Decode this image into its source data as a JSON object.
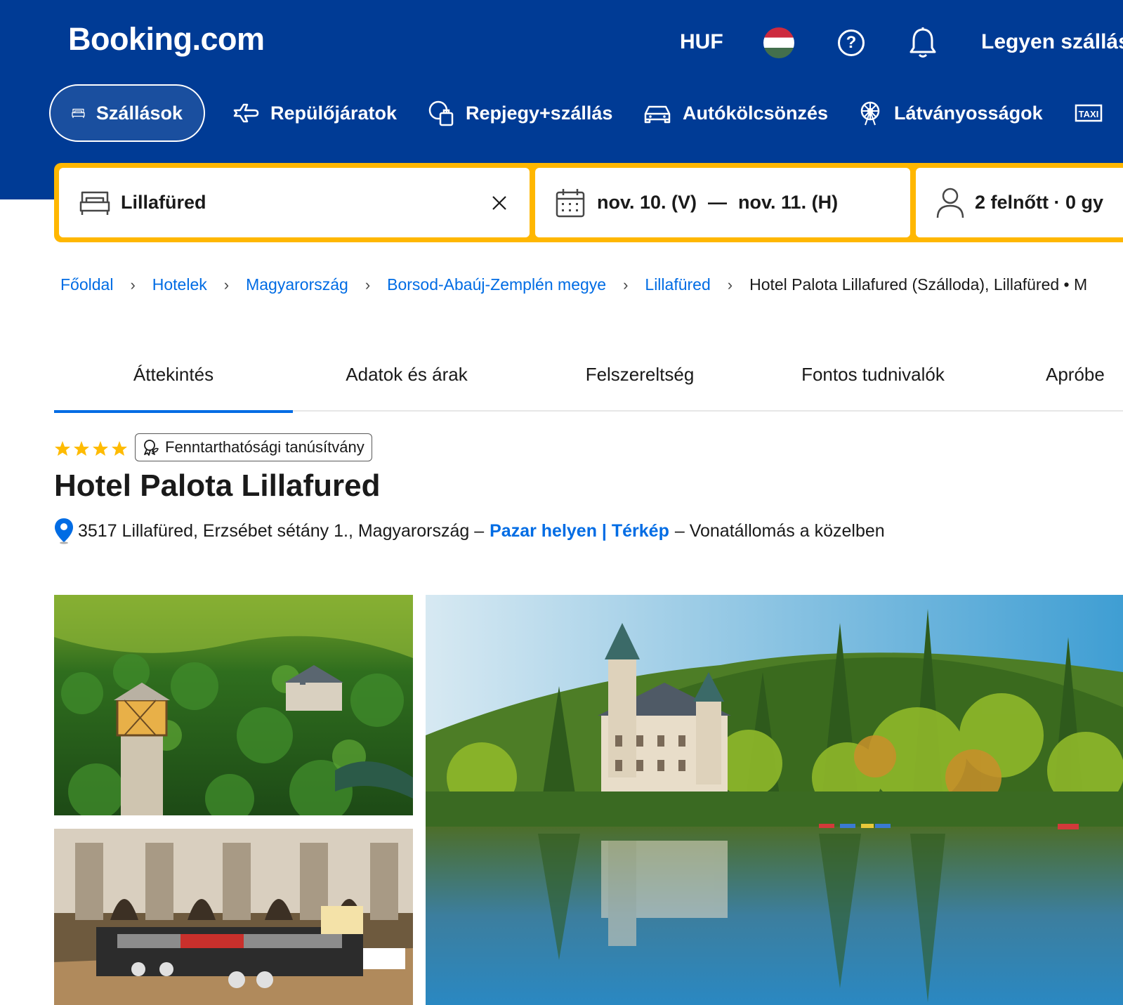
{
  "header": {
    "logo": "Booking.com",
    "currency": "HUF",
    "list_property": "Legyen szállás"
  },
  "nav": {
    "items": [
      {
        "label": "Szállások",
        "icon": "bed-icon",
        "active": true
      },
      {
        "label": "Repülőjáratok",
        "icon": "plane-icon"
      },
      {
        "label": "Repjegy+szállás",
        "icon": "flight-hotel-icon"
      },
      {
        "label": "Autókölcsönzés",
        "icon": "car-icon"
      },
      {
        "label": "Látványosságok",
        "icon": "attractions-icon"
      },
      {
        "label": "TAXI",
        "icon": "taxi-icon"
      }
    ]
  },
  "search": {
    "destination": "Lillafüred",
    "date_from": "nov. 10. (V)",
    "date_sep": "—",
    "date_to": "nov. 11. (H)",
    "guests": "2 felnőtt · 0 gy"
  },
  "breadcrumb": {
    "items": [
      "Főoldal",
      "Hotelek",
      "Magyarország",
      "Borsod-Abaúj-Zemplén megye",
      "Lillafüred"
    ],
    "current": "Hotel Palota Lillafured (Szálloda), Lillafüred • M"
  },
  "tabs": [
    "Áttekintés",
    "Adatok és árak",
    "Felszereltség",
    "Fontos tudnivalók",
    "Apróbe"
  ],
  "property": {
    "stars": 4,
    "badge": "Fenntarthatósági tanúsítvány",
    "name": "Hotel Palota Lillafured",
    "address": "3517 Lillafüred, Erzsébet sétány 1., Magyarország –",
    "location_link": "Pazar helyen | Térkép",
    "address_suffix": "– Vonatállomás a közelben"
  },
  "colors": {
    "brand_blue": "#003b95",
    "search_yellow": "#ffb700",
    "link_blue": "#006ce4",
    "star": "#febb02"
  }
}
